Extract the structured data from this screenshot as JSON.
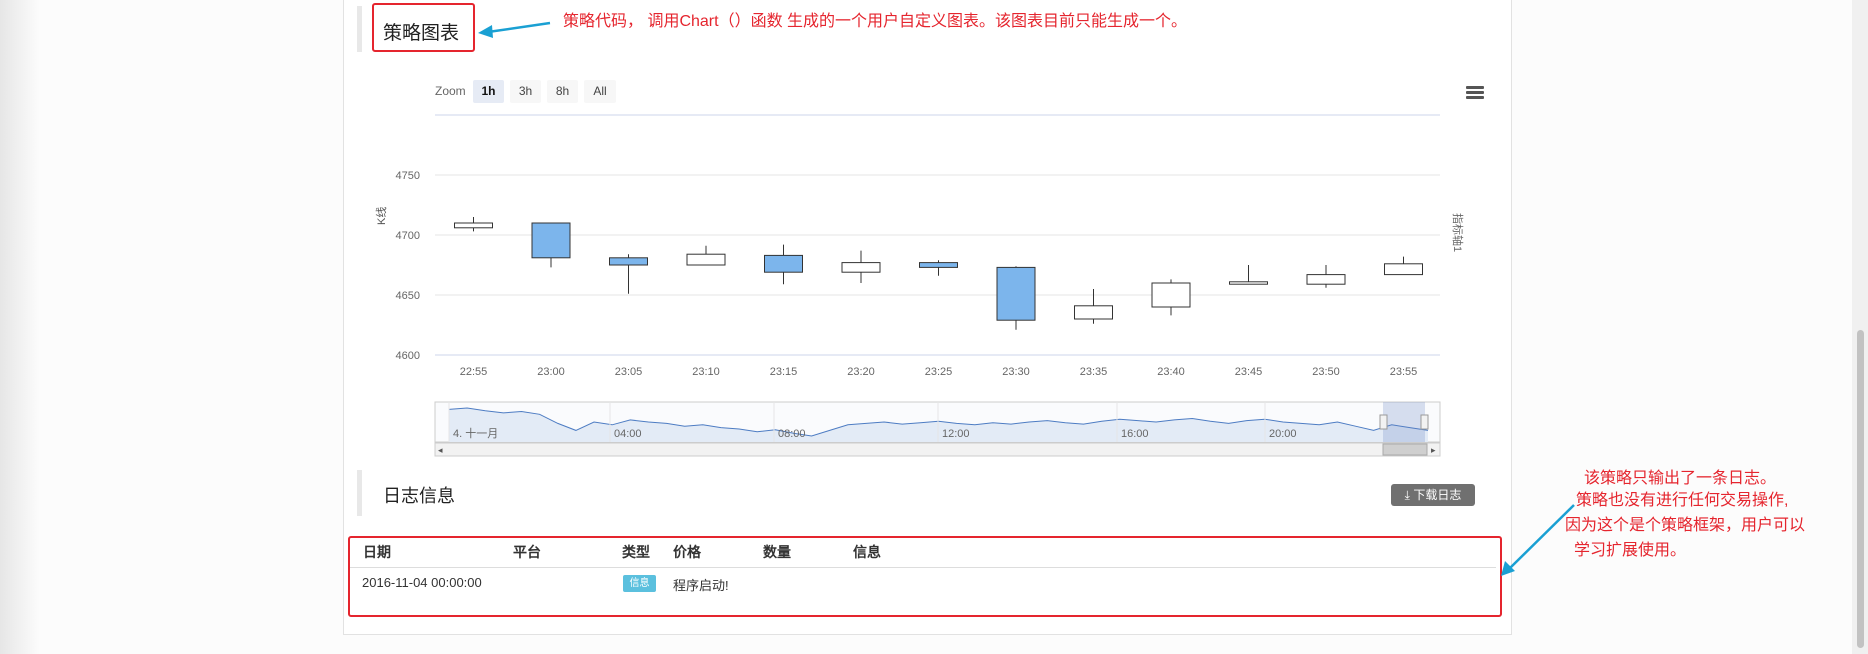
{
  "chart_section": {
    "title": "策略图表"
  },
  "annotations": {
    "chart_note": "策略代码， 调用Chart（）函数 生成的一个用户自定义图表。该图表目前只能生成一个。",
    "log_note_lines": [
      "该策略只输出了一条日志。",
      "策略也没有进行任何交易操作,",
      "因为这个是个策略框架，用户可以",
      "学习扩展使用。"
    ],
    "accent_color": "#e5252e",
    "arrow_color": "#1aa0d3"
  },
  "toolbar": {
    "zoom_label": "Zoom",
    "zoom_buttons": [
      "1h",
      "3h",
      "8h",
      "All"
    ],
    "active_zoom": "1h",
    "menu_icon": "hamburger-menu-icon"
  },
  "chart_data": {
    "type": "candlestick",
    "ylabel": "K线",
    "y2label": "指标轴1",
    "ylim": [
      4600,
      4750
    ],
    "yticks": [
      4600,
      4650,
      4700,
      4750
    ],
    "categories": [
      "22:55",
      "23:00",
      "23:05",
      "23:10",
      "23:15",
      "23:20",
      "23:25",
      "23:30",
      "23:35",
      "23:40",
      "23:45",
      "23:50",
      "23:55"
    ],
    "candles": [
      {
        "time": "22:55",
        "open": 4706,
        "high": 4715,
        "low": 4703,
        "close": 4710
      },
      {
        "time": "23:00",
        "open": 4710,
        "high": 4710,
        "low": 4673,
        "close": 4681
      },
      {
        "time": "23:05",
        "open": 4681,
        "high": 4684,
        "low": 4651,
        "close": 4675
      },
      {
        "time": "23:10",
        "open": 4675,
        "high": 4691,
        "low": 4675,
        "close": 4684
      },
      {
        "time": "23:15",
        "open": 4683,
        "high": 4692,
        "low": 4659,
        "close": 4669
      },
      {
        "time": "23:20",
        "open": 4669,
        "high": 4687,
        "low": 4660,
        "close": 4677
      },
      {
        "time": "23:25",
        "open": 4677,
        "high": 4679,
        "low": 4666,
        "close": 4673
      },
      {
        "time": "23:30",
        "open": 4673,
        "high": 4674,
        "low": 4621,
        "close": 4629
      },
      {
        "time": "23:35",
        "open": 4630,
        "high": 4655,
        "low": 4626,
        "close": 4641
      },
      {
        "time": "23:40",
        "open": 4640,
        "high": 4663,
        "low": 4633,
        "close": 4660
      },
      {
        "time": "23:45",
        "open": 4659,
        "high": 4675,
        "low": 4659,
        "close": 4661
      },
      {
        "time": "23:50",
        "open": 4659,
        "high": 4675,
        "low": 4656,
        "close": 4667
      },
      {
        "time": "23:55",
        "open": 4667,
        "high": 4682,
        "low": 4667,
        "close": 4676
      }
    ],
    "up_color": "#ffffff",
    "down_color": "#7cb5ec",
    "navigator": {
      "labels": [
        "4. 十一月",
        "04:00",
        "08:00",
        "12:00",
        "16:00",
        "20:00"
      ],
      "series": [
        4690,
        4692,
        4688,
        4685,
        4687,
        4683,
        4670,
        4660,
        4672,
        4668,
        4675,
        4672,
        4670,
        4666,
        4668,
        4664,
        4662,
        4658,
        4661,
        4656,
        4652,
        4660,
        4668,
        4670,
        4672,
        4669,
        4671,
        4673,
        4670,
        4668,
        4671,
        4669,
        4672,
        4674,
        4671,
        4669,
        4673,
        4676,
        4674,
        4672,
        4675,
        4677,
        4673,
        4670,
        4674,
        4676,
        4672,
        4670,
        4668,
        4672,
        4666,
        4660,
        4668,
        4664,
        4660
      ]
    }
  },
  "log_section": {
    "title": "日志信息",
    "download_label": "下载日志",
    "download_icon": "download-icon",
    "columns": [
      "日期",
      "平台",
      "类型",
      "价格",
      "数量",
      "信息"
    ],
    "rows": [
      {
        "date": "2016-11-04 00:00:00",
        "platform": "",
        "type": "信息",
        "price": "",
        "amount": "",
        "message": "程序启动!"
      }
    ]
  }
}
